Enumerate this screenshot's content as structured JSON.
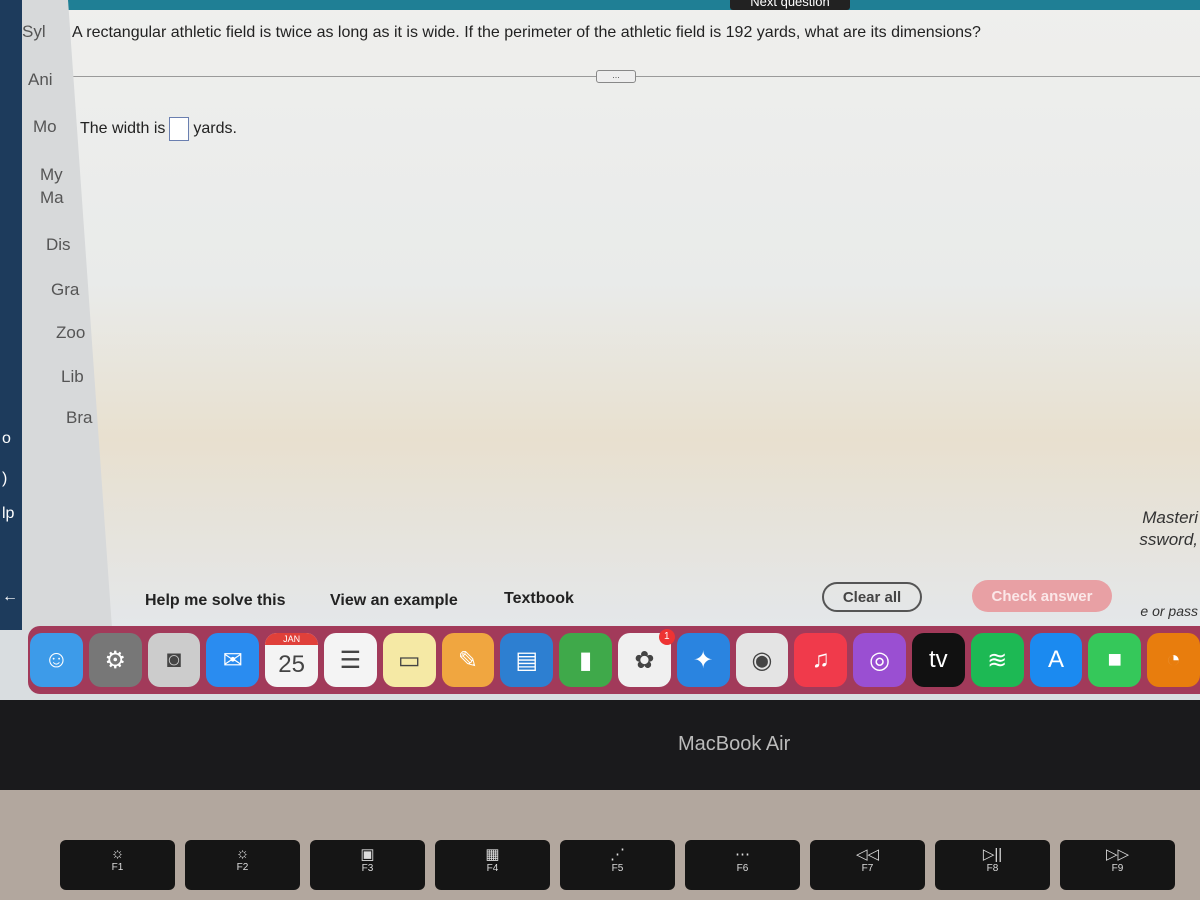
{
  "background": {
    "left_strip": [
      "o",
      ")",
      "lp",
      "←"
    ],
    "sidebar": [
      "Syl",
      "Ani",
      "Mo",
      "My",
      "Ma",
      "Dis",
      "Gra",
      "Zoo",
      "Lib",
      "Bra"
    ],
    "right_text": [
      "Masteri",
      "ssword,",
      "e or pass"
    ]
  },
  "dialog": {
    "next_label": "Next question",
    "question": "A rectangular athletic field is twice as long as it is wide. If the perimeter of the athletic field is 192 yards, what are its dimensions?",
    "more_label": "...",
    "answer_prefix": "The width is",
    "answer_value": "",
    "answer_suffix": "yards.",
    "actions": {
      "help": "Help me solve this",
      "example": "View an example",
      "textbook": "Textbook",
      "clear": "Clear all",
      "check": "Check answer"
    },
    "accent": "#1f7f95"
  },
  "dock": {
    "apps": [
      {
        "name": "finder",
        "glyph": "☺",
        "color": "#3d9be9"
      },
      {
        "name": "system-preferences",
        "glyph": "⚙",
        "color": "#777"
      },
      {
        "name": "screenshot",
        "glyph": "◙",
        "color": "#ccc"
      },
      {
        "name": "mail",
        "glyph": "✉",
        "color": "#2a8cf0"
      },
      {
        "name": "calendar",
        "glyph": "25",
        "month": "JAN",
        "color": "#f4f4f4"
      },
      {
        "name": "reminders",
        "glyph": "☰",
        "color": "#f4f4f4"
      },
      {
        "name": "notes",
        "glyph": "▭",
        "color": "#f5e9a5"
      },
      {
        "name": "pages",
        "glyph": "✎",
        "color": "#f0a640"
      },
      {
        "name": "keynote",
        "glyph": "▤",
        "color": "#2d7fd1"
      },
      {
        "name": "numbers",
        "glyph": "▮",
        "color": "#3fa94a"
      },
      {
        "name": "photos",
        "glyph": "✿",
        "color": "#f0f0f0",
        "badge": "1"
      },
      {
        "name": "safari",
        "glyph": "✦",
        "color": "#2a84e0"
      },
      {
        "name": "chrome",
        "glyph": "◉",
        "color": "#e4e4e4"
      },
      {
        "name": "music",
        "glyph": "♫",
        "color": "#f03a4b"
      },
      {
        "name": "podcasts",
        "glyph": "◎",
        "color": "#9a4fd2"
      },
      {
        "name": "apple-tv",
        "glyph": "tv",
        "color": "#111"
      },
      {
        "name": "spotify",
        "glyph": "≋",
        "color": "#1db954"
      },
      {
        "name": "app-store",
        "glyph": "A",
        "color": "#1b8af0"
      },
      {
        "name": "facetime",
        "glyph": "■",
        "color": "#35c85a"
      },
      {
        "name": "blender",
        "glyph": "◔",
        "color": "#e87d0d"
      }
    ]
  },
  "bezel_label": "MacBook Air",
  "keys": [
    {
      "icon": "☼",
      "label": "F1"
    },
    {
      "icon": "☼",
      "label": "F2"
    },
    {
      "icon": "▣",
      "label": "F3"
    },
    {
      "icon": "▦",
      "label": "F4"
    },
    {
      "icon": "⋰",
      "label": "F5"
    },
    {
      "icon": "⋯",
      "label": "F6"
    },
    {
      "icon": "◁◁",
      "label": "F7"
    },
    {
      "icon": "▷||",
      "label": "F8"
    },
    {
      "icon": "▷▷",
      "label": "F9"
    }
  ]
}
